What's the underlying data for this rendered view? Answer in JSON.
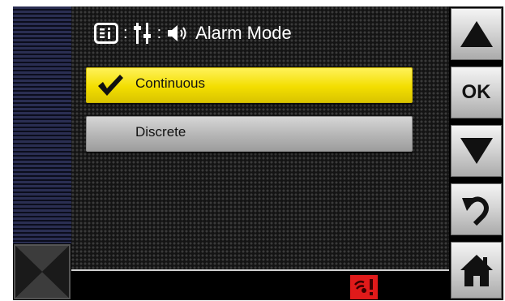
{
  "header": {
    "title": "Alarm Mode",
    "separator": ":",
    "icons": [
      "menu-info-icon",
      "settings-sliders-icon",
      "speaker-icon"
    ]
  },
  "options": [
    {
      "label": "Continuous",
      "selected": true
    },
    {
      "label": "Discrete",
      "selected": false
    }
  ],
  "buttons": {
    "up": "up-arrow-icon",
    "ok_label": "OK",
    "down": "down-arrow-icon",
    "back": "back-arrow-icon",
    "home": "home-icon"
  },
  "status": {
    "alarm_icon": "alarm-bell-icon"
  },
  "colors": {
    "selected": "#f3de00",
    "unselected": "#b5b5b5",
    "alarm": "#e01a1a"
  }
}
